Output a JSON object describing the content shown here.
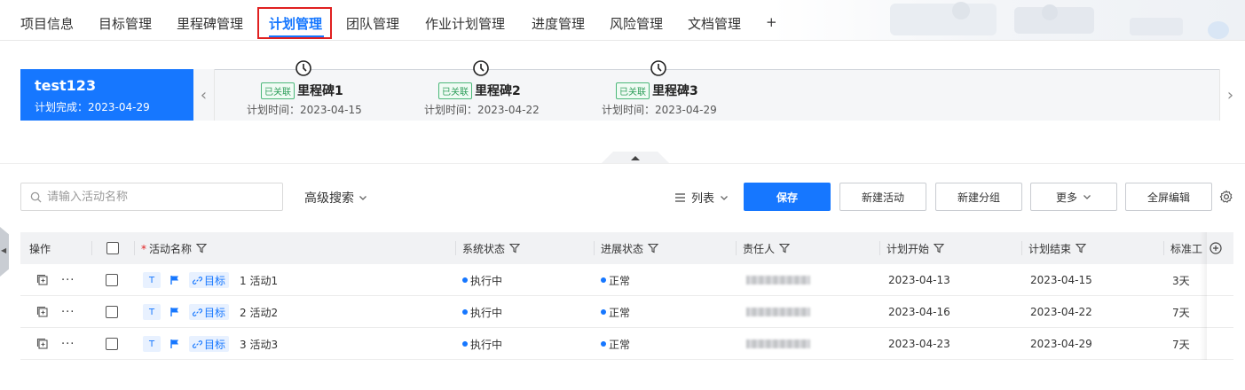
{
  "top_tabs": [
    {
      "label": "项目信息"
    },
    {
      "label": "目标管理"
    },
    {
      "label": "里程碑管理"
    },
    {
      "label": "计划管理",
      "active": true
    },
    {
      "label": "团队管理"
    },
    {
      "label": "作业计划管理"
    },
    {
      "label": "进度管理"
    },
    {
      "label": "风险管理"
    },
    {
      "label": "文档管理"
    },
    {
      "label": "+"
    }
  ],
  "plan": {
    "name": "test123",
    "finish_label": "计划完成：",
    "finish_date": "2023-04-29"
  },
  "milestones": [
    {
      "badge": "已关联",
      "title": "里程碑1",
      "time_label": "计划时间：",
      "time": "2023-04-15"
    },
    {
      "badge": "已关联",
      "title": "里程碑2",
      "time_label": "计划时间：",
      "time": "2023-04-22"
    },
    {
      "badge": "已关联",
      "title": "里程碑3",
      "time_label": "计划时间：",
      "time": "2023-04-29"
    }
  ],
  "toolbar": {
    "search_placeholder": "请输入活动名称",
    "advanced_search": "高级搜索",
    "view_mode": "列表",
    "save": "保存",
    "new_activity": "新建活动",
    "new_group": "新建分组",
    "more": "更多",
    "fullscreen_edit": "全屏编辑"
  },
  "table": {
    "headers": {
      "actions": "操作",
      "name": "活动名称",
      "system_status": "系统状态",
      "progress_status": "进展状态",
      "owner": "责任人",
      "plan_start": "计划开始",
      "plan_end": "计划结束",
      "standard": "标准工"
    },
    "rows": [
      {
        "actions_more": "···",
        "tag_t": "T",
        "goal": "目标",
        "name": "1 活动1",
        "system_status": "执行中",
        "progress_status": "正常",
        "plan_start": "2023-04-13",
        "plan_end": "2023-04-15",
        "standard": "3天"
      },
      {
        "actions_more": "···",
        "tag_t": "T",
        "goal": "目标",
        "name": "2 活动2",
        "system_status": "执行中",
        "progress_status": "正常",
        "plan_start": "2023-04-16",
        "plan_end": "2023-04-22",
        "standard": "7天"
      },
      {
        "actions_more": "···",
        "tag_t": "T",
        "goal": "目标",
        "name": "3 活动3",
        "system_status": "执行中",
        "progress_status": "正常",
        "plan_start": "2023-04-23",
        "plan_end": "2023-04-29",
        "standard": "7天"
      }
    ]
  },
  "colors": {
    "accent": "#1677ff",
    "highlight_border": "#e02020",
    "linked_badge": "#2e9e5a"
  }
}
